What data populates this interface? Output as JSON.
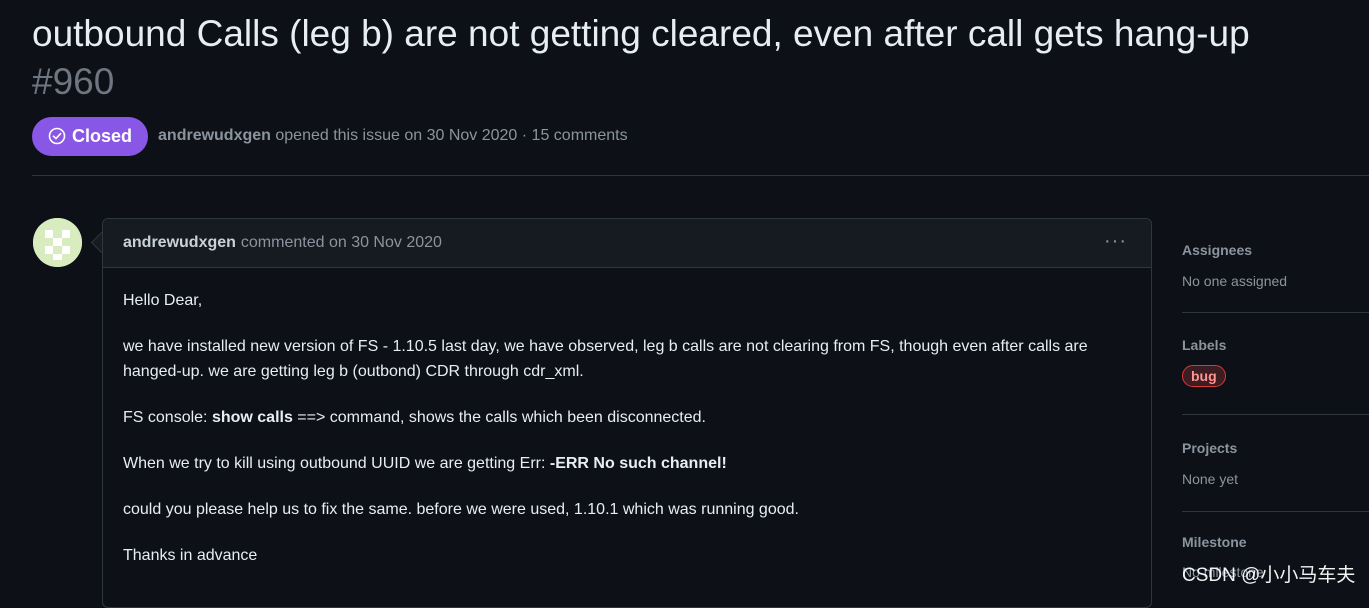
{
  "issue": {
    "title": "outbound Calls (leg b) are not getting cleared, even after call gets hang-up",
    "number": "#960",
    "state": "Closed",
    "author": "andrewudxgen",
    "meta": "opened this issue on 30 Nov 2020 · 15 comments"
  },
  "comment": {
    "author": "andrewudxgen",
    "meta": "commented on 30 Nov 2020",
    "more_label": "···",
    "p1": "Hello Dear,",
    "p2": "we have installed new version of FS - 1.10.5 last day, we have observed, leg b calls are not clearing from FS, though even after calls are hanged-up. we are getting leg b (outbond) CDR through cdr_xml.",
    "p3_pre": "FS console: ",
    "p3_bold": "show calls",
    "p3_post": " ==> command, shows the calls which been disconnected.",
    "p4_pre": "When we try to kill using outbound UUID we are getting Err: ",
    "p4_bold": "-ERR No such channel!",
    "p5": "could you please help us to fix the same. before we were used, 1.10.1 which was running good.",
    "p6": "Thanks in advance"
  },
  "sidebar": {
    "assignees_title": "Assignees",
    "assignees_value": "No one assigned",
    "labels_title": "Labels",
    "label_bug": "bug",
    "projects_title": "Projects",
    "projects_value": "None yet",
    "milestone_title": "Milestone",
    "milestone_value": "No milestone"
  },
  "watermark": "CSDN @小小马车夫",
  "colors": {
    "background": "#0d1117",
    "closed_badge": "#8957e5",
    "label_bug_border": "#da3633",
    "border": "#30363d"
  },
  "icons": [
    "check-circle-icon",
    "kebab-menu-icon",
    "avatar-identicon"
  ]
}
